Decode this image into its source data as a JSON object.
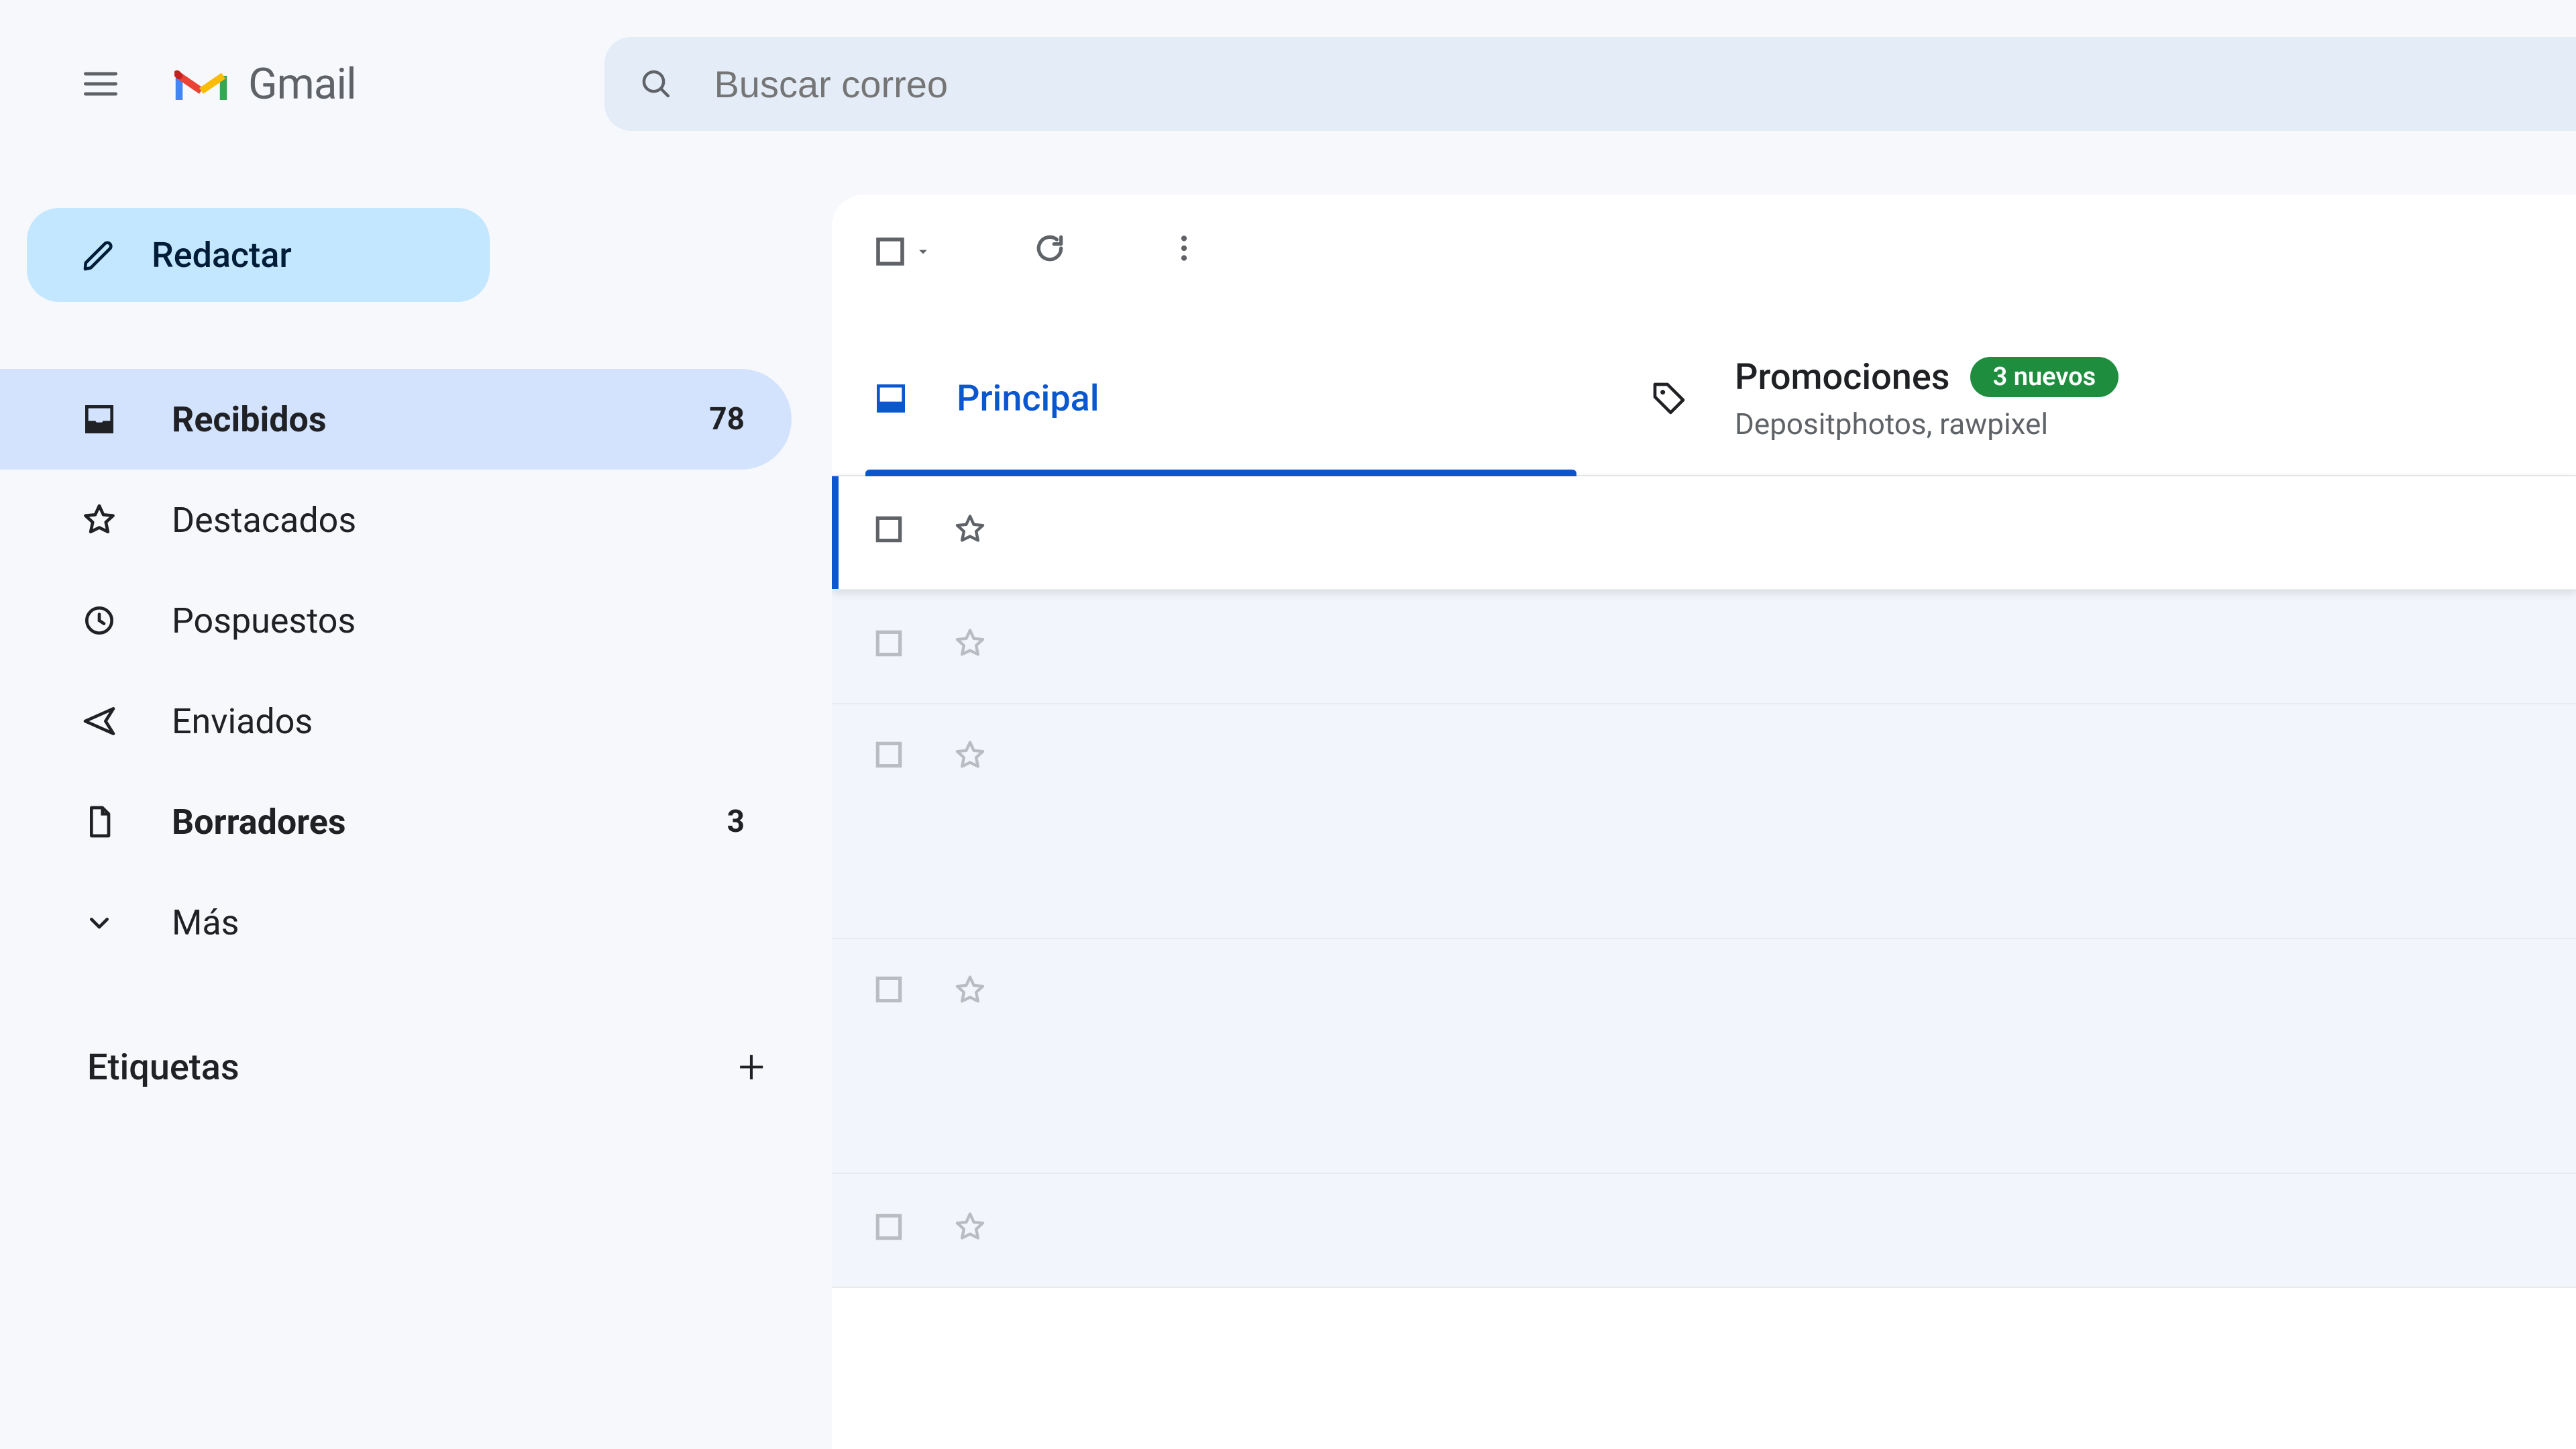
{
  "header": {
    "app_name": "Gmail",
    "search_placeholder": "Buscar correo"
  },
  "compose": {
    "label": "Redactar"
  },
  "sidebar": {
    "items": [
      {
        "id": "inbox",
        "label": "Recibidos",
        "count": "78",
        "bold": true,
        "active": true
      },
      {
        "id": "starred",
        "label": "Destacados",
        "count": "",
        "bold": false,
        "active": false
      },
      {
        "id": "snoozed",
        "label": "Pospuestos",
        "count": "",
        "bold": false,
        "active": false
      },
      {
        "id": "sent",
        "label": "Enviados",
        "count": "",
        "bold": false,
        "active": false
      },
      {
        "id": "drafts",
        "label": "Borradores",
        "count": "3",
        "bold": true,
        "active": false
      },
      {
        "id": "more",
        "label": "Más",
        "count": "",
        "bold": false,
        "active": false
      }
    ],
    "labels_heading": "Etiquetas"
  },
  "tabs": {
    "primary": {
      "label": "Principal"
    },
    "promotions": {
      "label": "Promociones",
      "badge": "3 nuevos",
      "sub": "Depositphotos, rawpixel"
    }
  },
  "rows": [
    {
      "unread": true,
      "tall": false
    },
    {
      "unread": false,
      "tall": false
    },
    {
      "unread": false,
      "tall": true
    },
    {
      "unread": false,
      "tall": true
    },
    {
      "unread": false,
      "tall": false
    }
  ]
}
